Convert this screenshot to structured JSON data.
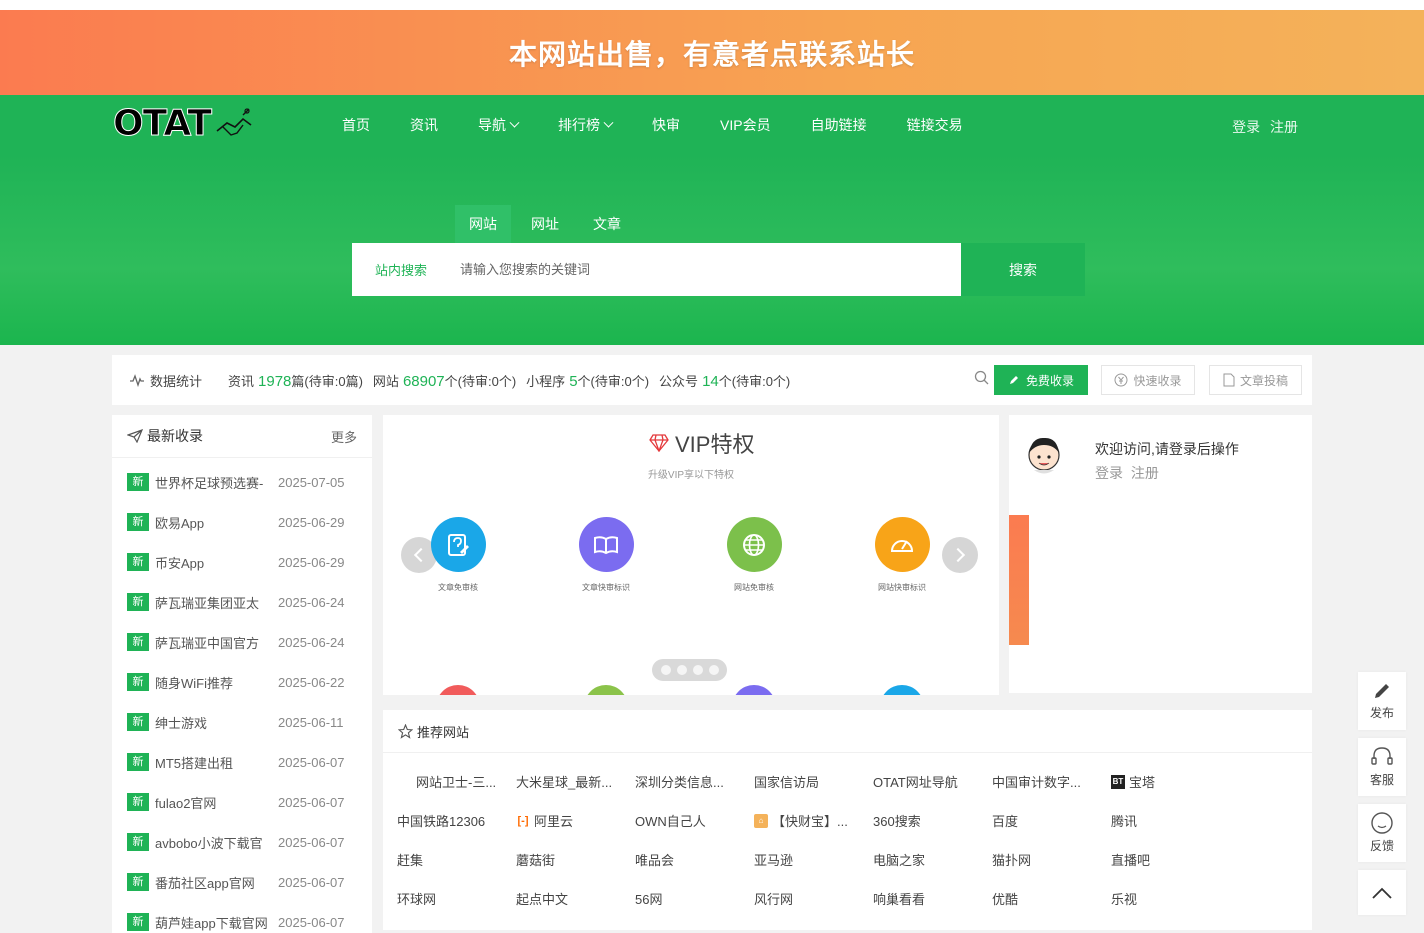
{
  "banner": {
    "text": "本网站出售，有意者点联系站长"
  },
  "header": {
    "logo_text": "OTAT",
    "nav": [
      {
        "label": "首页",
        "dropdown": false
      },
      {
        "label": "资讯",
        "dropdown": false
      },
      {
        "label": "导航",
        "dropdown": true
      },
      {
        "label": "排行榜",
        "dropdown": true
      },
      {
        "label": "快审",
        "dropdown": false
      },
      {
        "label": "VIP会员",
        "dropdown": false
      },
      {
        "label": "自助链接",
        "dropdown": false
      },
      {
        "label": "链接交易",
        "dropdown": false
      }
    ],
    "login": "登录",
    "register": "注册"
  },
  "search": {
    "tabs": [
      "网站",
      "网址",
      "文章"
    ],
    "active_tab": "网站",
    "scope_label": "站内搜索",
    "placeholder": "请输入您搜索的关键词",
    "button": "搜索"
  },
  "stats": {
    "title": "数据统计",
    "items": [
      {
        "label": "资讯",
        "count": "1978",
        "suffix": "篇(待审:0篇)"
      },
      {
        "label": "网站",
        "count": "68907",
        "suffix": "个(待审:0个)"
      },
      {
        "label": "小程序",
        "count": "5",
        "suffix": "个(待审:0个)"
      },
      {
        "label": "公众号",
        "count": "14",
        "suffix": "个(待审:0个)"
      }
    ],
    "btn_free": "免费收录",
    "btn_fast": "快速收录",
    "btn_article": "文章投稿"
  },
  "latest": {
    "title": "最新收录",
    "more": "更多",
    "badge": "新",
    "items": [
      {
        "name": "世界杯足球预选赛-",
        "date": "2025-07-05"
      },
      {
        "name": "欧易App",
        "date": "2025-06-29"
      },
      {
        "name": "币安App",
        "date": "2025-06-29"
      },
      {
        "name": "萨瓦瑞亚集团亚太",
        "date": "2025-06-24"
      },
      {
        "name": "萨瓦瑞亚中国官方",
        "date": "2025-06-24"
      },
      {
        "name": "随身WiFi推荐",
        "date": "2025-06-22"
      },
      {
        "name": "绅士游戏",
        "date": "2025-06-11"
      },
      {
        "name": "MT5搭建出租",
        "date": "2025-06-07"
      },
      {
        "name": "fulao2官网",
        "date": "2025-06-07"
      },
      {
        "name": "avbobo小波下载官",
        "date": "2025-06-07"
      },
      {
        "name": "番茄社区app官网",
        "date": "2025-06-07"
      },
      {
        "name": "葫芦娃app下载官网",
        "date": "2025-06-07"
      }
    ]
  },
  "vip": {
    "title": "VIP特权",
    "subtitle": "升级VIP享以下特权",
    "features": [
      {
        "label": "文章免审核",
        "color": "#1aa7e8",
        "icon": "edit-doc-icon"
      },
      {
        "label": "文章快审标识",
        "color": "#7b6cf0",
        "icon": "book-icon"
      },
      {
        "label": "网站免审核",
        "color": "#7cc04b",
        "icon": "globe-icon"
      },
      {
        "label": "网站快审标识",
        "color": "#f8a418",
        "icon": "speedometer-icon"
      }
    ],
    "peek_colors": [
      "#f15b5b",
      "#8bc34a",
      "#7b6cf0",
      "#1aa7e8"
    ]
  },
  "welcome": {
    "text": "欢迎访问,请登录后操作",
    "login": "登录",
    "register": "注册"
  },
  "recommend": {
    "title": "推荐网站",
    "rows": [
      [
        {
          "name": "网站卫士-三...",
          "icon": ""
        },
        {
          "name": "大米星球_最新...",
          "icon": ""
        },
        {
          "name": "深圳分类信息...",
          "icon": ""
        },
        {
          "name": "国家信访局",
          "icon": ""
        },
        {
          "name": "OTAT网址导航",
          "icon": ""
        },
        {
          "name": "中国审计数字...",
          "icon": ""
        },
        {
          "name": "宝塔",
          "icon": "bt"
        }
      ],
      [
        {
          "name": "中国铁路12306",
          "icon": ""
        },
        {
          "name": "阿里云",
          "icon": "aliyun"
        },
        {
          "name": "OWN自己人",
          "icon": ""
        },
        {
          "name": "【快财宝】...",
          "icon": "house"
        },
        {
          "name": "360搜索",
          "icon": ""
        },
        {
          "name": "百度",
          "icon": ""
        },
        {
          "name": "腾讯",
          "icon": ""
        }
      ],
      [
        {
          "name": "赶集",
          "icon": ""
        },
        {
          "name": "蘑菇街",
          "icon": ""
        },
        {
          "name": "唯品会",
          "icon": ""
        },
        {
          "name": "亚马逊",
          "icon": ""
        },
        {
          "name": "电脑之家",
          "icon": ""
        },
        {
          "name": "猫扑网",
          "icon": ""
        },
        {
          "name": "直播吧",
          "icon": ""
        }
      ],
      [
        {
          "name": "环球网",
          "icon": ""
        },
        {
          "name": "起点中文",
          "icon": ""
        },
        {
          "name": "56网",
          "icon": ""
        },
        {
          "name": "风行网",
          "icon": ""
        },
        {
          "name": "响巢看看",
          "icon": ""
        },
        {
          "name": "优酷",
          "icon": ""
        },
        {
          "name": "乐视",
          "icon": ""
        }
      ]
    ]
  },
  "floatbar": {
    "publish": "发布",
    "service": "客服",
    "feedback": "反馈"
  }
}
